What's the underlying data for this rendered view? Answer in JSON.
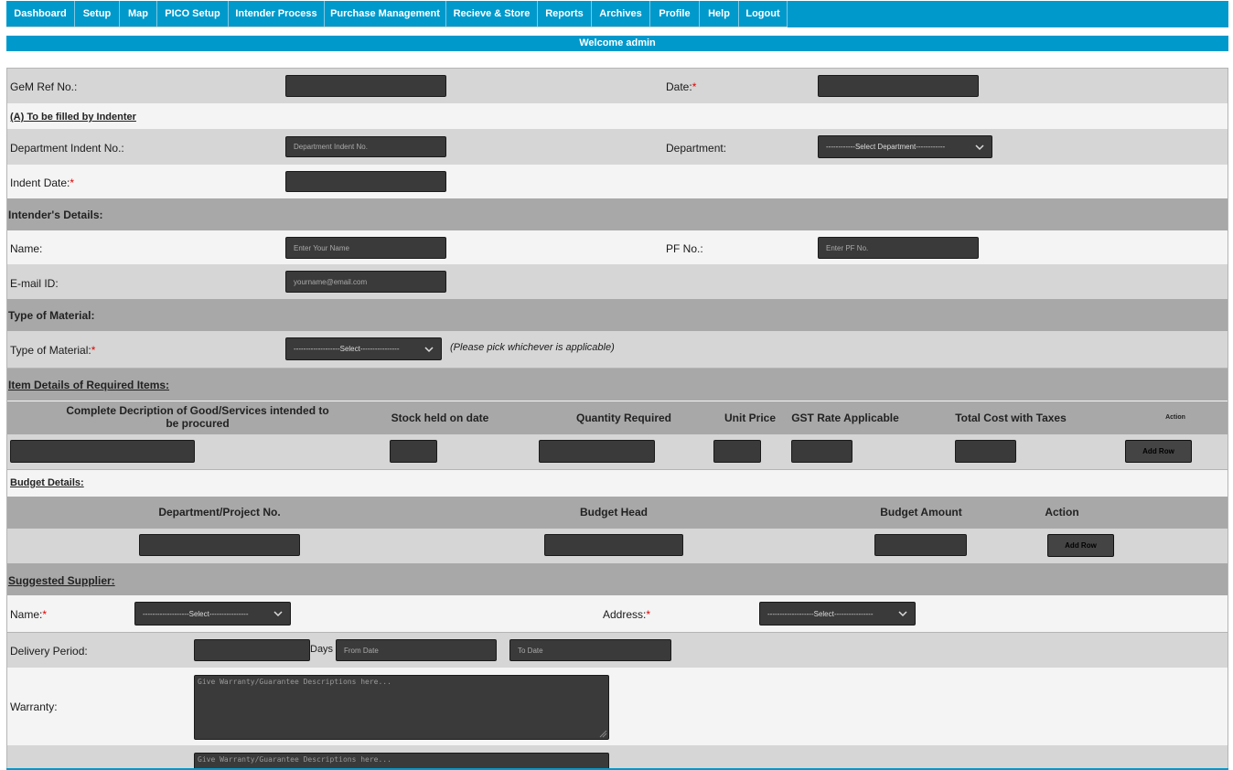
{
  "nav": {
    "items": [
      "Dashboard",
      "Setup",
      "Map",
      "PICO Setup",
      "Intender Process",
      "Purchase Management",
      "Recieve & Store",
      "Reports",
      "Archives",
      "Profile",
      "Help",
      "Logout"
    ]
  },
  "welcome": "Welcome admin",
  "form": {
    "gem_ref_label": "GeM Ref No.:",
    "date_label": "Date:",
    "required_mark": "*",
    "section_a": "(A) To be filled by Indenter",
    "dept_indent_label": "Department Indent No.:",
    "dept_indent_placeholder": "Department Indent No.",
    "department_label": "Department:",
    "department_select": "------------Select Department------------",
    "indent_date_label": "Indent Date:",
    "intender_header": "Intender's Details:",
    "name_label": "Name:",
    "name_placeholder": "Enter Your Name",
    "pf_label": "PF No.:",
    "pf_placeholder": "Enter PF No.",
    "email_label": "E-mail ID:",
    "email_placeholder": "yourname@email.com",
    "material_header": "Type of Material:",
    "material_label": "Type of Material:",
    "material_select": "-------------------Select----------------",
    "material_hint": "(Please pick whichever is applicable)",
    "items_header": "Item Details of Required Items:",
    "items_columns": {
      "desc": "Complete Decription of Good/Services intended to be procured",
      "stock": "Stock held on date",
      "qty": "Quantity Required",
      "price": "Unit Price",
      "gst": "GST Rate Applicable",
      "total": "Total Cost with Taxes",
      "action": "Action"
    },
    "add_row": "Add Row",
    "budget_header": "Budget Details:",
    "budget_columns": {
      "project": "Department/Project No.",
      "head": "Budget Head",
      "amount": "Budget Amount",
      "action": "Action"
    },
    "supplier_header": "Suggested Supplier:",
    "supplier_name_label": "Name:",
    "supplier_name_select": "-------------------Select----------------",
    "address_label": "Address:",
    "address_select": "-------------------Select----------------",
    "delivery_label": "Delivery Period:",
    "days_label": "Days",
    "from_date_placeholder": "From Date",
    "to_date_placeholder": "To Date",
    "warranty_label": "Warranty:",
    "warranty_placeholder": "Give Warranty/Guarantee Descriptions here...",
    "warranty2_placeholder": "Give Warranty/Guarantee Descriptions here..."
  }
}
